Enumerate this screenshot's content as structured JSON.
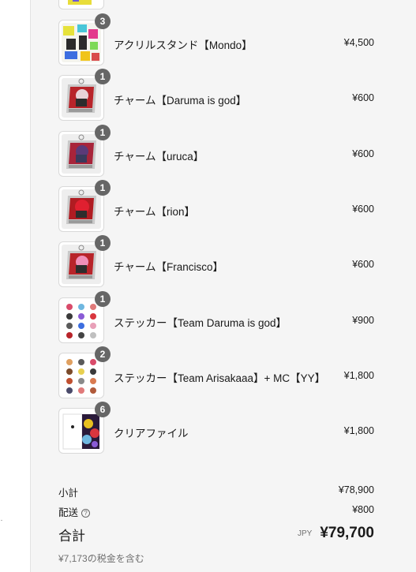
{
  "items": [
    {
      "name": "アクリルスタンド【Mondo】",
      "price": "¥4,500",
      "qty": "3",
      "icon": "acrylic-stand-image"
    },
    {
      "name": "チャーム【Daruma is god】",
      "price": "¥600",
      "qty": "1",
      "icon": "charm-image"
    },
    {
      "name": "チャーム【uruca】",
      "price": "¥600",
      "qty": "1",
      "icon": "charm-image"
    },
    {
      "name": "チャーム【rion】",
      "price": "¥600",
      "qty": "1",
      "icon": "charm-image"
    },
    {
      "name": "チャーム【Francisco】",
      "price": "¥600",
      "qty": "1",
      "icon": "charm-image"
    },
    {
      "name": "ステッカー【Team Daruma is god】",
      "price": "¥900",
      "qty": "1",
      "icon": "sticker-sheet-image"
    },
    {
      "name": "ステッカー【Team Arisakaaa】+ MC【YY】",
      "price": "¥1,800",
      "qty": "2",
      "icon": "sticker-sheet-image"
    },
    {
      "name": "クリアファイル",
      "price": "¥1,800",
      "qty": "6",
      "icon": "clear-file-image"
    }
  ],
  "summary": {
    "subtotal_label": "小計",
    "subtotal_value": "¥78,900",
    "shipping_label": "配送",
    "shipping_help_icon": "question-circle-icon",
    "shipping_value": "¥800",
    "total_label": "合計",
    "currency": "JPY",
    "total_value": "¥79,700",
    "tax_note": "¥7,173の税金を含む"
  },
  "colors": {
    "panel_background": "#f5f5f5",
    "badge_background": "#666666",
    "text": "#1a1a1a",
    "muted_text": "#707070"
  }
}
